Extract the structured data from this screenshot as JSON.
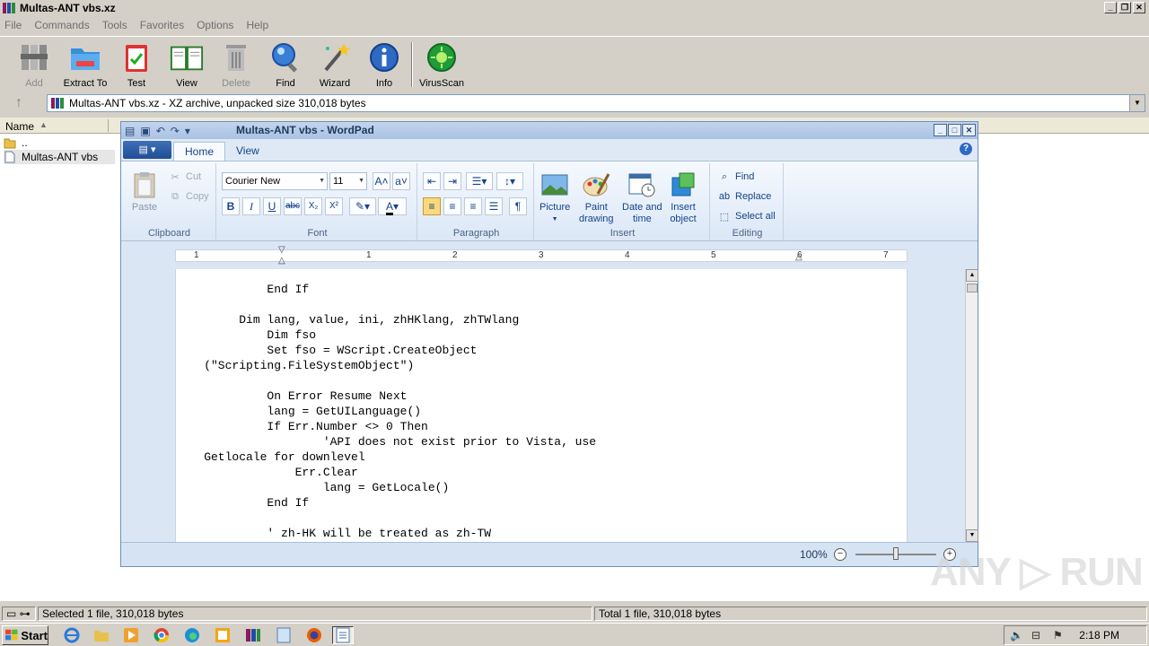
{
  "app": {
    "title": "Multas-ANT vbs.xz",
    "menu": [
      "File",
      "Commands",
      "Tools",
      "Favorites",
      "Options",
      "Help"
    ],
    "toolbar": [
      {
        "label": "Add",
        "icon": "add-archive-icon",
        "enabled": false
      },
      {
        "label": "Extract To",
        "icon": "extract-folder-icon",
        "enabled": true
      },
      {
        "label": "Test",
        "icon": "test-clipboard-icon",
        "enabled": true
      },
      {
        "label": "View",
        "icon": "view-book-icon",
        "enabled": true
      },
      {
        "label": "Delete",
        "icon": "trash-icon",
        "enabled": false
      },
      {
        "label": "Find",
        "icon": "magnifier-icon",
        "enabled": true
      },
      {
        "label": "Wizard",
        "icon": "wand-icon",
        "enabled": true
      },
      {
        "label": "Info",
        "icon": "info-icon",
        "enabled": true
      },
      {
        "label": "VirusScan",
        "icon": "virus-scan-icon",
        "enabled": true
      }
    ],
    "address": "Multas-ANT vbs.xz - XZ archive, unpacked size 310,018 bytes",
    "column_name": "Name",
    "files": [
      {
        "name": "..",
        "type": "folder"
      },
      {
        "name": "Multas-ANT vbs",
        "type": "file",
        "selected": true
      }
    ],
    "status_left": "Selected 1 file, 310,018 bytes",
    "status_right": "Total 1 file, 310,018 bytes"
  },
  "wordpad": {
    "title": "Multas-ANT vbs - WordPad",
    "tabs": [
      "Home",
      "View"
    ],
    "clipboard": {
      "paste": "Paste",
      "cut": "Cut",
      "copy": "Copy",
      "group": "Clipboard"
    },
    "font": {
      "family": "Courier New",
      "size": "11",
      "group": "Font"
    },
    "paragraph_group": "Paragraph",
    "insert": {
      "picture": "Picture",
      "paint1": "Paint",
      "paint2": "drawing",
      "date1": "Date and",
      "date2": "time",
      "obj1": "Insert",
      "obj2": "object",
      "group": "Insert"
    },
    "editing": {
      "find": "Find",
      "replace": "Replace",
      "select_all": "Select all",
      "group": "Editing"
    },
    "ruler_numbers": [
      "1",
      "1",
      "2",
      "3",
      "4",
      "5",
      "6",
      "7"
    ],
    "document_lines": [
      "             End If",
      "",
      "         Dim lang, value, ini, zhHKlang, zhTWlang",
      "             Dim fso",
      "             Set fso = WScript.CreateObject",
      "    (\"Scripting.FileSystemObject\")",
      "",
      "             On Error Resume Next",
      "             lang = GetUILanguage()",
      "             If Err.Number <> 0 Then",
      "                     'API does not exist prior to Vista, use",
      "    Getlocale for downlevel",
      "                 Err.Clear",
      "                     lang = GetLocale()",
      "             End If",
      "",
      "             ' zh-HK will be treated as zh-TW"
    ],
    "zoom": "100%"
  },
  "taskbar": {
    "start": "Start",
    "clock": "2:18 PM"
  },
  "watermark": "ANY RUN"
}
